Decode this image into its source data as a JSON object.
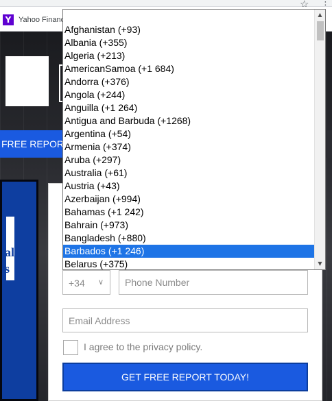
{
  "browser": {
    "bookmark_label": "Yahoo Finance",
    "favicon_letter": "Y",
    "star_icon": "☆",
    "menu_icon": "⋮"
  },
  "page": {
    "report_bar_label": "FREE REPORT",
    "left_card_text": [
      "al",
      "s"
    ]
  },
  "form": {
    "country_code": "+34",
    "phone_placeholder": "Phone Number",
    "email_placeholder": "Email Address",
    "agree_label": "I agree to the privacy policy.",
    "submit_label": "GET FREE REPORT TODAY!"
  },
  "dropdown": {
    "selected_index": 17,
    "options": [
      "Afghanistan (+93)",
      "Albania (+355)",
      "Algeria (+213)",
      "AmericanSamoa (+1 684)",
      "Andorra (+376)",
      "Angola (+244)",
      "Anguilla (+1 264)",
      "Antigua and Barbuda (+1268)",
      "Argentina (+54)",
      "Armenia (+374)",
      "Aruba (+297)",
      "Australia (+61)",
      "Austria (+43)",
      "Azerbaijan (+994)",
      "Bahamas (+1 242)",
      "Bahrain (+973)",
      "Bangladesh (+880)",
      "Barbados (+1 246)",
      "Belarus (+375)"
    ]
  },
  "colors": {
    "accent_blue": "#1a5ae0",
    "selected_option": "#1e74e6",
    "left_panel": "#0e3ea0"
  }
}
